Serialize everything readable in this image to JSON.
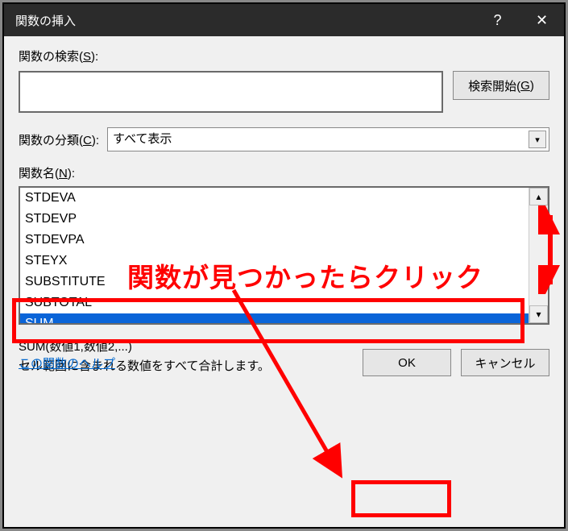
{
  "title": "関数の挿入",
  "labels": {
    "search": "関数の検索(S):",
    "category": "関数の分類(C):",
    "name": "関数名(N):"
  },
  "buttons": {
    "search": "検索開始(G)",
    "ok": "OK",
    "cancel": "キャンセル"
  },
  "category": {
    "selected": "すべて表示"
  },
  "functions": {
    "items": [
      "STDEVA",
      "STDEVP",
      "STDEVPA",
      "STEYX",
      "SUBSTITUTE",
      "SUBTOTAL",
      "SUM"
    ],
    "selectedIndex": 6
  },
  "description": {
    "syntax": "SUM(数値1,数値2,...)",
    "text": "セル範囲に含まれる数値をすべて合計します。"
  },
  "help_link": "この関数のヘルプ",
  "annotation": {
    "text": "関数が見つかったらクリック"
  }
}
